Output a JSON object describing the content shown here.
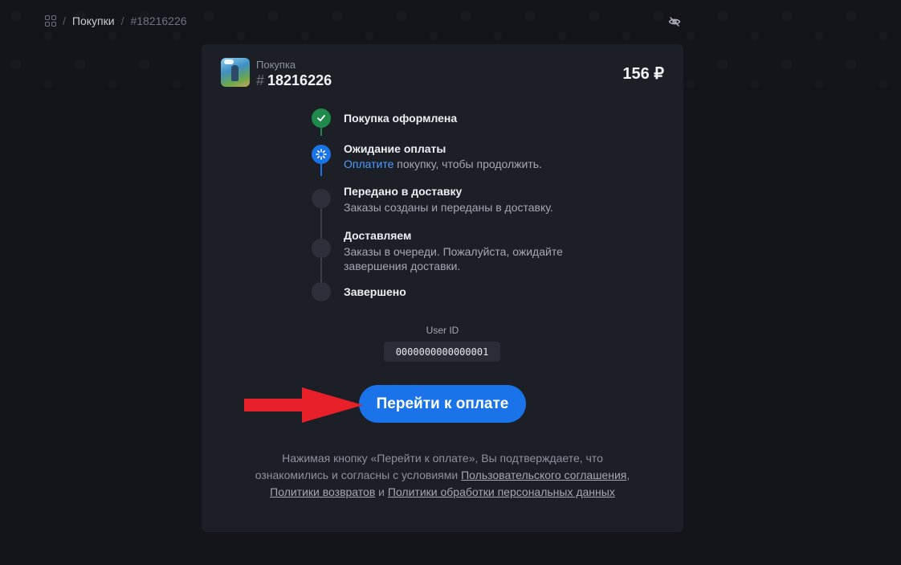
{
  "breadcrumb": {
    "purchases_label": "Покупки",
    "current": "#18216226",
    "separator": "/"
  },
  "order": {
    "purchase_label": "Покупка",
    "hash": "#",
    "id": "18216226",
    "price": "156 ₽"
  },
  "steps": [
    {
      "title": "Покупка оформлена",
      "status": "done"
    },
    {
      "title": "Ожидание оплаты",
      "desc_link": "Оплатите",
      "desc_rest": " покупку, чтобы продолжить.",
      "status": "active"
    },
    {
      "title": "Передано в доставку",
      "desc": "Заказы созданы и переданы в доставку.",
      "status": "pending"
    },
    {
      "title": "Доставляем",
      "desc": "Заказы в очереди. Пожалуйста, ожидайте завершения доставки.",
      "status": "pending"
    },
    {
      "title": "Завершено",
      "status": "pending"
    }
  ],
  "user": {
    "label": "User ID",
    "id": "0000000000000001"
  },
  "pay_button": {
    "label": "Перейти к оплате"
  },
  "notice": {
    "line1": "Нажимая кнопку «Перейти к оплате», Вы подтверждаете, что",
    "line2_pre": "ознакомились и согласны с условиями ",
    "user_agreement": "Пользовательского соглашения",
    "comma": ",",
    "refund_policy": "Политики возвратов",
    "and": " и ",
    "privacy_policy": "Политики обработки персональных данных"
  },
  "colors": {
    "accent": "#1a73e8",
    "success": "#1f8a4c",
    "annotation_arrow": "#e8202a"
  },
  "icons": [
    "grid-icon",
    "eye-off-icon",
    "check-icon",
    "spinner-icon",
    "arrow-annotation"
  ]
}
